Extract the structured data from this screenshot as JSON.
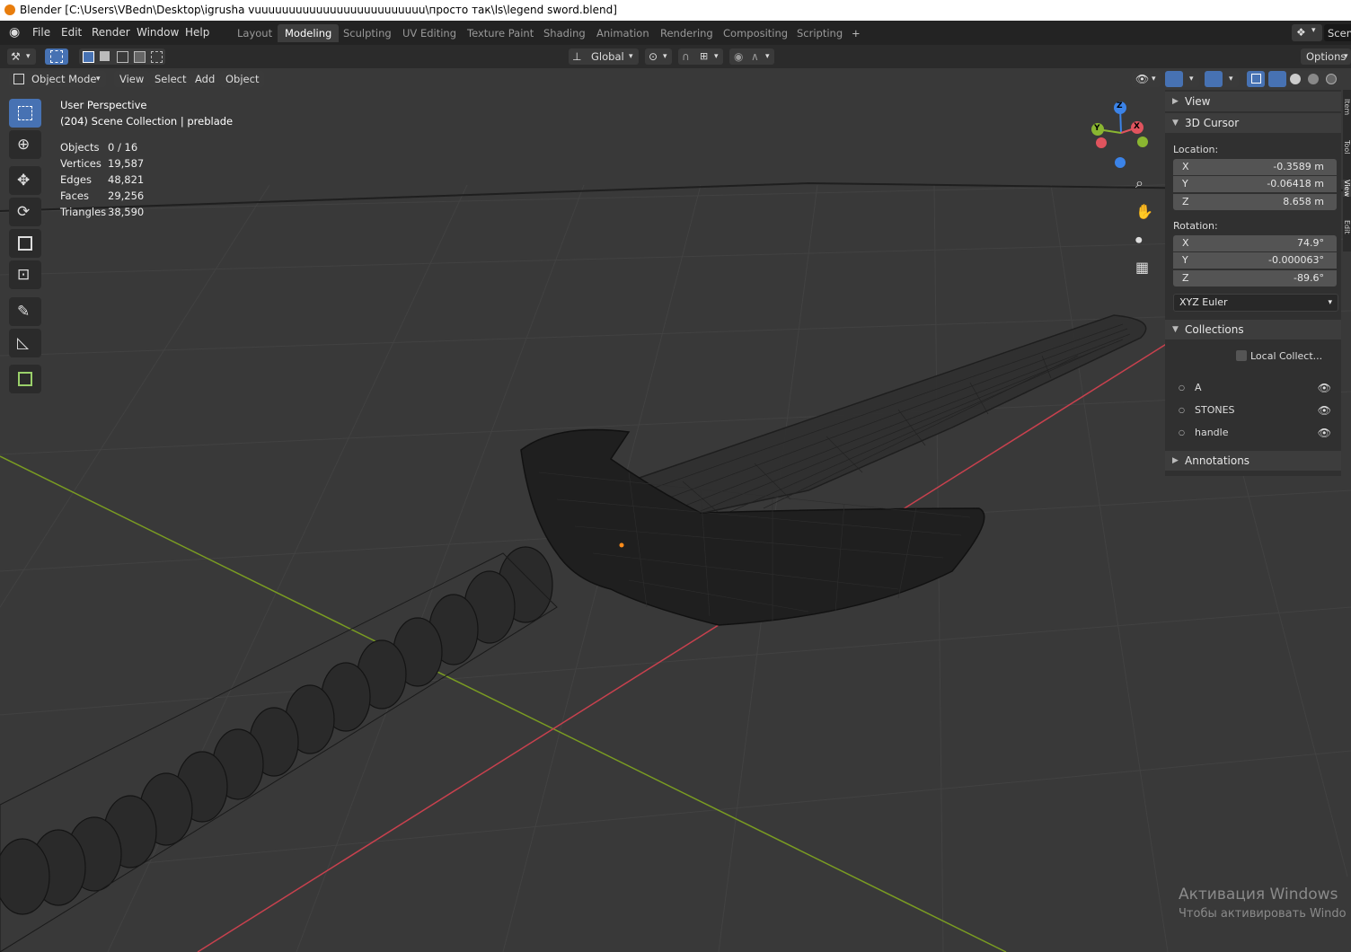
{
  "window": {
    "title": "Blender [C:\\Users\\VBedn\\Desktop\\igrusha vuuuuuuuuuuuuuuuuuuuuuuuuu\\просто так\\ls\\legend sword.blend]"
  },
  "menu": [
    "File",
    "Edit",
    "Render",
    "Window",
    "Help"
  ],
  "workspaces": [
    {
      "label": "Layout",
      "active": false
    },
    {
      "label": "Modeling",
      "active": true
    },
    {
      "label": "Sculpting",
      "active": false
    },
    {
      "label": "UV Editing",
      "active": false
    },
    {
      "label": "Texture Paint",
      "active": false
    },
    {
      "label": "Shading",
      "active": false
    },
    {
      "label": "Animation",
      "active": false
    },
    {
      "label": "Rendering",
      "active": false
    },
    {
      "label": "Compositing",
      "active": false
    },
    {
      "label": "Scripting",
      "active": false
    }
  ],
  "add_workspace": "+",
  "scene_label": "Scene",
  "toolheader": {
    "transform_orientation": "Global",
    "options_label": "Options"
  },
  "viewport_header": {
    "mode": "Object Mode",
    "menus": [
      "View",
      "Select",
      "Add",
      "Object"
    ]
  },
  "overlay": {
    "perspective": "User Perspective",
    "collection": "(204) Scene Collection | preblade",
    "stats": [
      {
        "label": "Objects",
        "value": "0 / 16"
      },
      {
        "label": "Vertices",
        "value": "19,587"
      },
      {
        "label": "Edges",
        "value": "48,821"
      },
      {
        "label": "Faces",
        "value": "29,256"
      },
      {
        "label": "Triangles",
        "value": "38,590"
      }
    ]
  },
  "tools": [
    "select-box-icon",
    "cursor-icon",
    "move-icon",
    "rotate-icon",
    "scale-icon",
    "transform-icon",
    "annotate-icon",
    "measure-icon",
    "add-cube-icon"
  ],
  "gizmo": {
    "z": "Z",
    "y": "Y",
    "x": "X"
  },
  "sidebar": {
    "view_panel": "View",
    "cursor_panel": "3D Cursor",
    "location_label": "Location:",
    "location": [
      {
        "axis": "X",
        "value": "-0.3589 m"
      },
      {
        "axis": "Y",
        "value": "-0.06418 m"
      },
      {
        "axis": "Z",
        "value": "8.658 m"
      }
    ],
    "rotation_label": "Rotation:",
    "rotation": [
      {
        "axis": "X",
        "value": "74.9°"
      },
      {
        "axis": "Y",
        "value": "-0.000063°"
      },
      {
        "axis": "Z",
        "value": "-89.6°"
      }
    ],
    "rotation_mode": "XYZ Euler",
    "collections_panel": "Collections",
    "local_collections": "Local Collect...",
    "collections": [
      "A",
      "STONES",
      "handle"
    ],
    "annotations_panel": "Annotations",
    "tabs": [
      "Item",
      "Tool",
      "View",
      "Edit"
    ]
  },
  "watermark": {
    "line1": "Активация Windows",
    "line2": "Чтобы активировать Windo"
  },
  "colors": {
    "accent": "#4772b3",
    "x_axis": "#c8414e",
    "y_axis": "#7a9c22",
    "viewport_bg": "#393939"
  }
}
